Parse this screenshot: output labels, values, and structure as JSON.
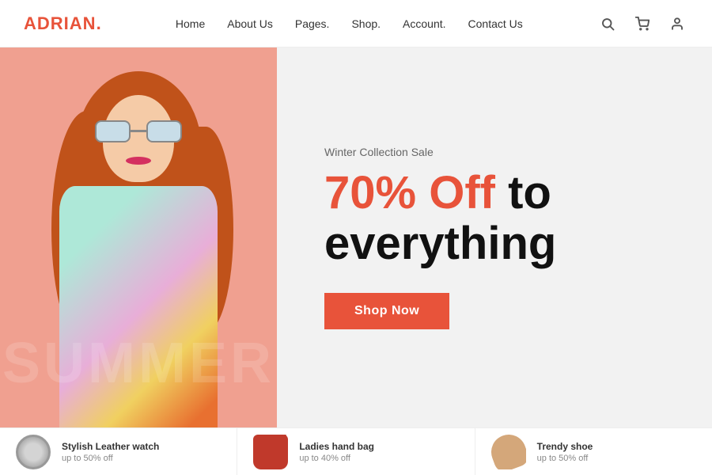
{
  "header": {
    "logo_text": "ADRIAN",
    "logo_dot": ".",
    "nav": [
      {
        "label": "Home",
        "id": "home"
      },
      {
        "label": "About Us",
        "id": "about"
      },
      {
        "label": "Pages.",
        "id": "pages"
      },
      {
        "label": "Shop.",
        "id": "shop"
      },
      {
        "label": "Account.",
        "id": "account"
      },
      {
        "label": "Contact Us",
        "id": "contact"
      }
    ]
  },
  "hero": {
    "sale_label": "Winter Collection Sale",
    "headline_orange": "70% Off",
    "headline_dark": " to everything",
    "cta_label": "Shop Now",
    "watermark": "SUMMER"
  },
  "products": [
    {
      "name": "Stylish Leather watch",
      "discount": "up to 50% off",
      "type": "watch"
    },
    {
      "name": "Ladies hand bag",
      "discount": "up to 40% off",
      "type": "bag"
    },
    {
      "name": "Trendy shoe",
      "discount": "up to 50% off",
      "type": "shoe"
    }
  ]
}
